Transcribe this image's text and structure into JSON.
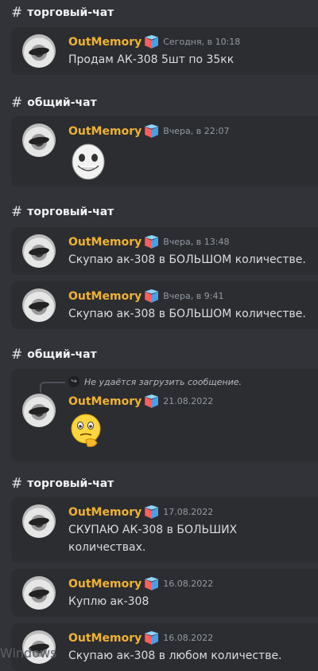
{
  "channels": {
    "trade": "торговый-чат",
    "general": "общий-чат"
  },
  "user": {
    "name": "OutMemory"
  },
  "messages": [
    {
      "time": "Сегодня, в 10:18",
      "text": "Продам АК-308 5шт по 35кк"
    },
    {
      "time": "Вчера, в 22:07",
      "emoji": "grinning-face-sticker"
    },
    {
      "time": "Вчера, в 13:48",
      "text": "Скупаю ак-308 в БОЛЬШОМ количестве."
    },
    {
      "time": "Вчера, в 9:41",
      "text": "Скупаю ак-308 в БОЛЬШОМ количестве."
    },
    {
      "reply": "Не удаётся загрузить сообщение.",
      "time": "21.08.2022",
      "emoji": "thinking-face"
    },
    {
      "time": "17.08.2022",
      "text_line1": "СКУПАЮ АК-308 в БОЛЬШИХ",
      "text_line2": "количествах."
    },
    {
      "time": "16.08.2022",
      "text": "Куплю ак-308"
    },
    {
      "time": "16.08.2022",
      "text": "Скупаю ак-308 в любом количестве."
    }
  ],
  "watermark": "Windows",
  "colors": {
    "background": "#313338",
    "card": "#2b2d31",
    "username": "#f0b232"
  }
}
